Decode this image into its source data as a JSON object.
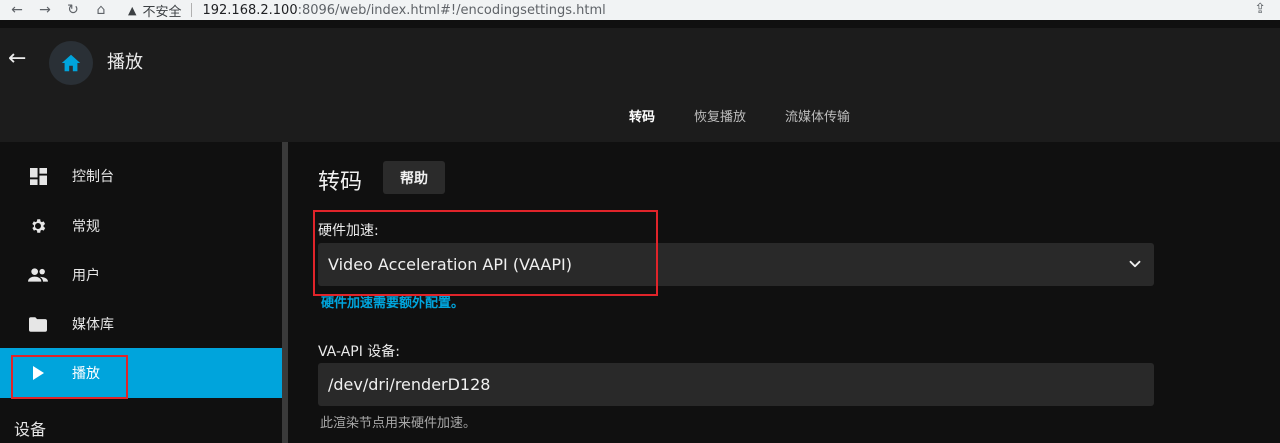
{
  "browser": {
    "insecure_label": "不安全",
    "url_host": "192.168.2.100",
    "url_path": ":8096/web/index.html#!/encodingsettings.html"
  },
  "header": {
    "title": "播放"
  },
  "tabs": [
    {
      "label": "转码",
      "active": true
    },
    {
      "label": "恢复播放",
      "active": false
    },
    {
      "label": "流媒体传输",
      "active": false
    }
  ],
  "sidebar": {
    "items": [
      {
        "label": "控制台",
        "icon": "dashboard-icon"
      },
      {
        "label": "常规",
        "icon": "gear-icon"
      },
      {
        "label": "用户",
        "icon": "users-icon"
      },
      {
        "label": "媒体库",
        "icon": "folder-icon"
      },
      {
        "label": "播放",
        "icon": "play-icon",
        "active": true
      }
    ],
    "section_label": "设备"
  },
  "main": {
    "title": "转码",
    "help_label": "帮助",
    "hw_label": "硬件加速:",
    "hw_value": "Video Acceleration API (VAAPI)",
    "hw_hint": "硬件加速需要额外配置。",
    "device_label": "VA-API 设备:",
    "device_value": "/dev/dri/renderD128",
    "device_hint": "此渲染节点用来硬件加速。"
  },
  "colors": {
    "accent": "#00a4dc",
    "highlight": "#e0242a",
    "background": "#101010",
    "header": "#1c1c1c"
  }
}
